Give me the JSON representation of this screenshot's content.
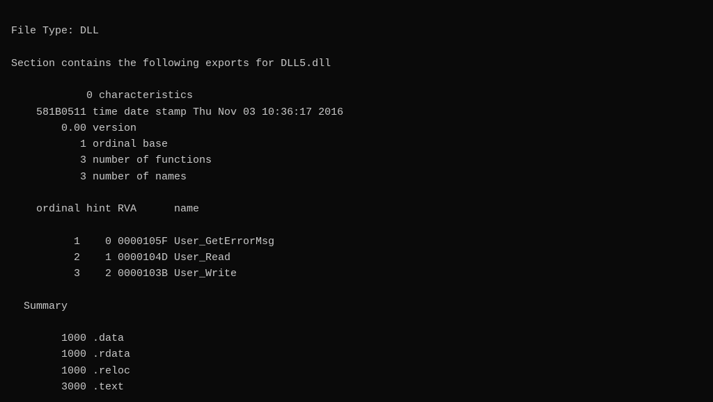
{
  "terminal": {
    "lines": [
      "File Type: DLL",
      "",
      "Section contains the following exports for DLL5.dll",
      "",
      "            0 characteristics",
      "    581B0511 time date stamp Thu Nov 03 10:36:17 2016",
      "        0.00 version",
      "           1 ordinal base",
      "           3 number of functions",
      "           3 number of names",
      "",
      "    ordinal hint RVA      name",
      "",
      "          1    0 0000105F User_GetErrorMsg",
      "          2    1 0000104D User_Read",
      "          3    2 0000103B User_Write",
      "",
      "  Summary",
      "",
      "        1000 .data",
      "        1000 .rdata",
      "        1000 .reloc",
      "        3000 .text"
    ]
  }
}
